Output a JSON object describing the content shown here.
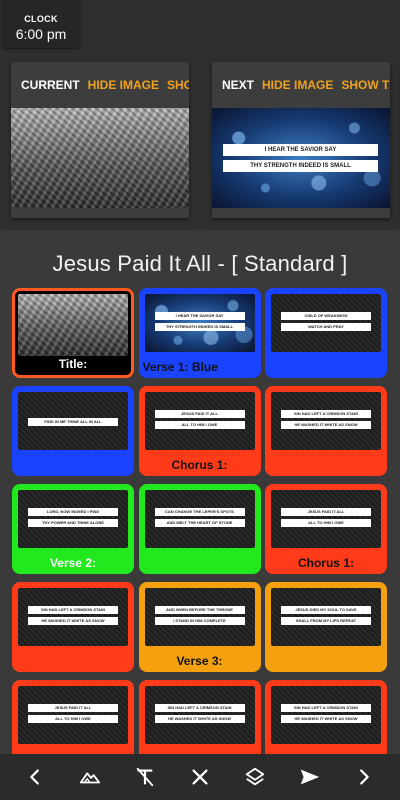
{
  "clock": {
    "label": "CLOCK",
    "time": "6:00 pm"
  },
  "current": {
    "caption": "CURRENT",
    "action1": "HIDE IMAGE",
    "action2": "SHOW TEXT"
  },
  "next": {
    "caption": "NEXT",
    "action1": "HIDE IMAGE",
    "action2": "SHOW TEXT",
    "lyrics": [
      "I HEAR THE SAVIOR SAY",
      "THY STRENGTH INDEED IS SMALL"
    ]
  },
  "song_title": "Jesus Paid It All - [ Standard ]",
  "tiles": [
    {
      "label": "Title:",
      "color": "#ff5a1f",
      "bg": "mountain",
      "lyrics": []
    },
    {
      "label": "Verse 1: Blue",
      "color": "#1a43ff",
      "bg": "bokeh",
      "lyrics": [
        "I HEAR THE SAVIOR SAY",
        "THY STRENGTH INDEED IS SMALL"
      ]
    },
    {
      "label": "",
      "color": "#1a43ff",
      "bg": "dark",
      "lyrics": [
        "CHILD OF WEAKNESS",
        "WATCH AND PRAY"
      ]
    },
    {
      "label": "",
      "color": "#1a43ff",
      "bg": "dark",
      "lyrics": [
        "FIND IN ME THINE ALL IN ALL"
      ]
    },
    {
      "label": "Chorus 1:",
      "color": "#ff3b1a",
      "bg": "dark",
      "lyrics": [
        "JESUS PAID IT ALL",
        "ALL TO HIM I OWE"
      ]
    },
    {
      "label": "",
      "color": "#ff3b1a",
      "bg": "dark",
      "lyrics": [
        "SIN HAD LEFT A CRIMSON STAIN",
        "HE WASHED IT WHITE AS SNOW"
      ]
    },
    {
      "label": "Verse 2:",
      "color": "#22e81e",
      "bg": "dark",
      "lyrics": [
        "LORD, NOW INDEED I FIND",
        "THY POWER AND THINE ALONE"
      ]
    },
    {
      "label": "",
      "color": "#22e81e",
      "bg": "dark",
      "lyrics": [
        "CAN CHANGE THE LEPER'S SPOTS",
        "AND MELT THE HEART OF STONE"
      ]
    },
    {
      "label": "Chorus 1:",
      "color": "#ff3b1a",
      "bg": "dark",
      "lyrics": [
        "JESUS PAID IT ALL",
        "ALL TO HIM I OWE"
      ]
    },
    {
      "label": "",
      "color": "#ff3b1a",
      "bg": "dark",
      "lyrics": [
        "SIN HAD LEFT A CRIMSON STAIN",
        "HE WASHED IT WHITE AS SNOW"
      ]
    },
    {
      "label": "Verse 3:",
      "color": "#f5a00f",
      "bg": "dark",
      "lyrics": [
        "AND WHEN BEFORE THE THRONE",
        "I STAND IN HIM COMPLETE"
      ]
    },
    {
      "label": "",
      "color": "#f5a00f",
      "bg": "dark",
      "lyrics": [
        "JESUS DIED MY SOUL TO SAVE",
        "SHALL FROM MY LIPS REPEAT"
      ]
    },
    {
      "label": "",
      "color": "#ff3b1a",
      "bg": "dark",
      "lyrics": [
        "JESUS PAID IT ALL",
        "ALL TO HIM I OWE"
      ]
    },
    {
      "label": "",
      "color": "#ff3b1a",
      "bg": "dark",
      "lyrics": [
        "SIN HAD LEFT A CRIMSON STAIN",
        "HE WASHED IT WHITE AS SNOW"
      ]
    },
    {
      "label": "",
      "color": "#ff3b1a",
      "bg": "dark",
      "lyrics": [
        "SIN HAD LEFT A CRIMSON STAIN",
        "HE WASHED IT WHITE AS SNOW"
      ]
    }
  ],
  "toolbar": {
    "icons": [
      "chevron-left-icon",
      "mountain-icon",
      "clear-format-icon",
      "close-icon",
      "layers-icon",
      "send-icon",
      "chevron-right-icon"
    ]
  }
}
